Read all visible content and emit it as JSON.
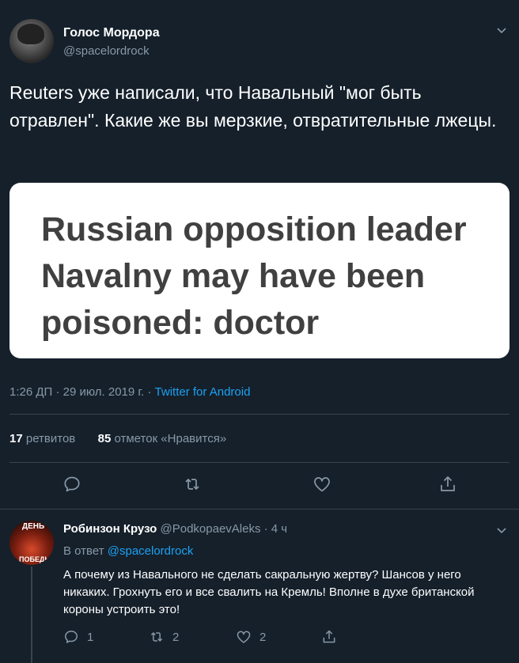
{
  "tweet": {
    "author_name": "Голос Мордора",
    "author_handle": "@spacelordrock",
    "text": "Reuters уже написали, что Навальный \"мог быть отравлен\". Какие же вы мерзкие, отвратительные лжецы.",
    "card_headline": "Russian opposition leader Navalny may have been poisoned: doctor",
    "time": "1:26 ДП · 29 июл. 2019 г. · ",
    "source": "Twitter for Android",
    "retweets_count": "17",
    "retweets_label": "ретвитов",
    "likes_count": "85",
    "likes_label": "отметок «Нравится»"
  },
  "reply": {
    "author_name": "Робинзон Крузо",
    "author_handle": "@PodkopaevAleks",
    "time": " · 4 ч",
    "reply_prefix": "В ответ ",
    "reply_mention": "@spacelordrock",
    "text": "А почему из Навального не сделать сакральную жертву? Шансов у него никаких. Грохнуть его и все свалить на Кремль! Вполне в духе британской короны устроить это!",
    "reply_count": "1",
    "retweet_count": "2",
    "like_count": "2",
    "avatar_text_top": "ДЕНЬ",
    "avatar_text_bottom": "ПОБЕДЫ"
  },
  "icons": {
    "reply": "comment-icon",
    "retweet": "retweet-icon",
    "like": "heart-icon",
    "share": "share-icon",
    "menu": "chevron-down-icon"
  },
  "colors": {
    "background": "#15202b",
    "accent": "#1da1f2",
    "secondary_text": "#8899a6",
    "divider": "#38444d"
  }
}
